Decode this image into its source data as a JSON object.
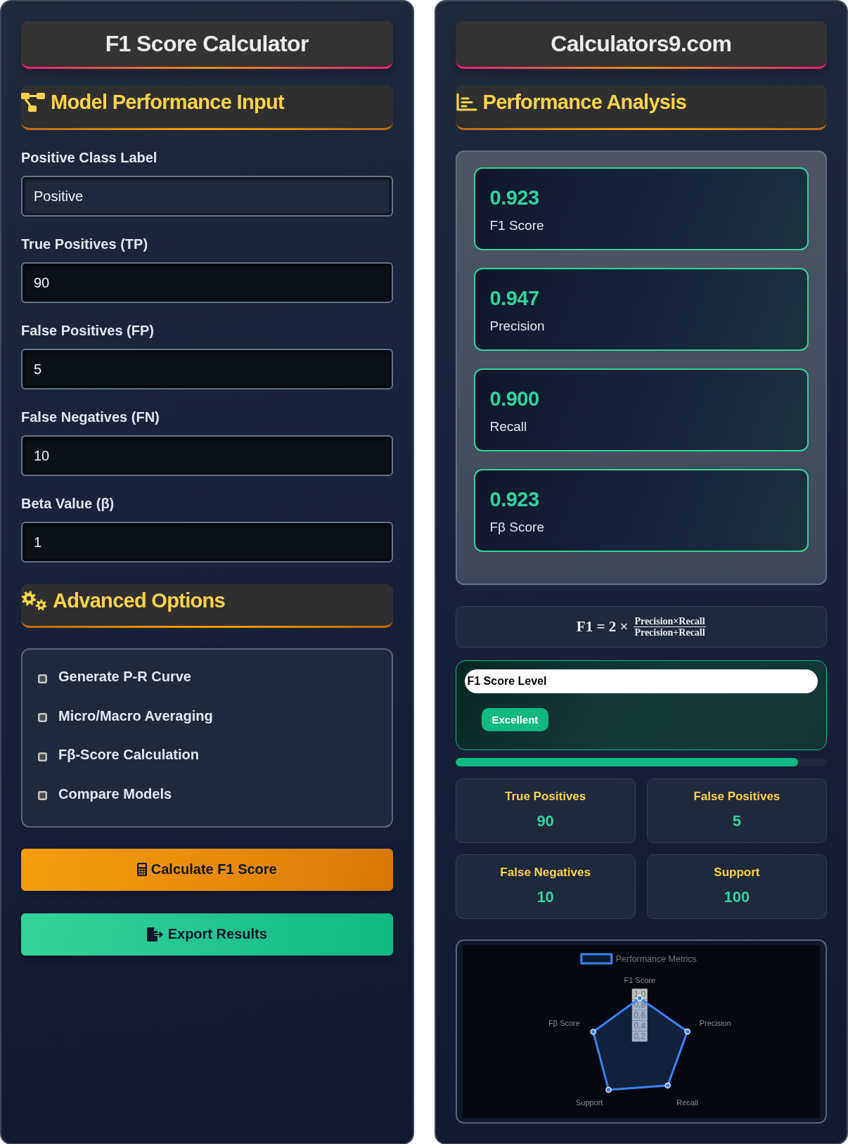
{
  "left_panel": {
    "title": "F1 Score Calculator",
    "input_section": {
      "heading": "Model Performance Input",
      "fields": [
        {
          "label": "Positive Class Label",
          "value": "Positive",
          "kind": "text"
        },
        {
          "label": "True Positives (TP)",
          "value": "90",
          "kind": "number"
        },
        {
          "label": "False Positives (FP)",
          "value": "5",
          "kind": "number"
        },
        {
          "label": "False Negatives (FN)",
          "value": "10",
          "kind": "number"
        },
        {
          "label": "Beta Value (β)",
          "value": "1",
          "kind": "number"
        }
      ]
    },
    "advanced_section": {
      "heading": "Advanced Options",
      "options": [
        {
          "label": "Generate P-R Curve",
          "checked": false
        },
        {
          "label": "Micro/Macro Averaging",
          "checked": false
        },
        {
          "label": "Fβ-Score Calculation",
          "checked": false
        },
        {
          "label": "Compare Models",
          "checked": false
        }
      ]
    },
    "buttons": [
      {
        "label": "Calculate F1 Score",
        "kind": "calculate"
      },
      {
        "label": "Export Results",
        "kind": "export"
      }
    ]
  },
  "right_panel": {
    "title": "Calculators9.com",
    "heading": "Performance Analysis",
    "results": [
      {
        "value": "0.923",
        "label": "F1 Score"
      },
      {
        "value": "0.947",
        "label": "Precision"
      },
      {
        "value": "0.900",
        "label": "Recall"
      },
      {
        "value": "0.923",
        "label": "Fβ Score"
      }
    ],
    "formula": {
      "lhs": "F1 = 2 ×",
      "numerator": "Precision×Recall",
      "denominator": "Precision+Recall"
    },
    "score_level": {
      "title": "F1 Score Level",
      "badge": "Excellent",
      "level": 0.923
    },
    "stats": [
      {
        "label": "True Positives",
        "value": "90"
      },
      {
        "label": "False Positives",
        "value": "5"
      },
      {
        "label": "False Negatives",
        "value": "10"
      },
      {
        "label": "Support",
        "value": "100"
      }
    ],
    "radar_chart": {
      "legend": "Performance Metrics",
      "axis_labels": [
        "F1 Score",
        "Precision",
        "Recall",
        "Support",
        "Fβ Score"
      ],
      "tick_labels": [
        "1,0",
        "0,8",
        "0,6",
        "0,4",
        "0,2"
      ]
    }
  }
}
